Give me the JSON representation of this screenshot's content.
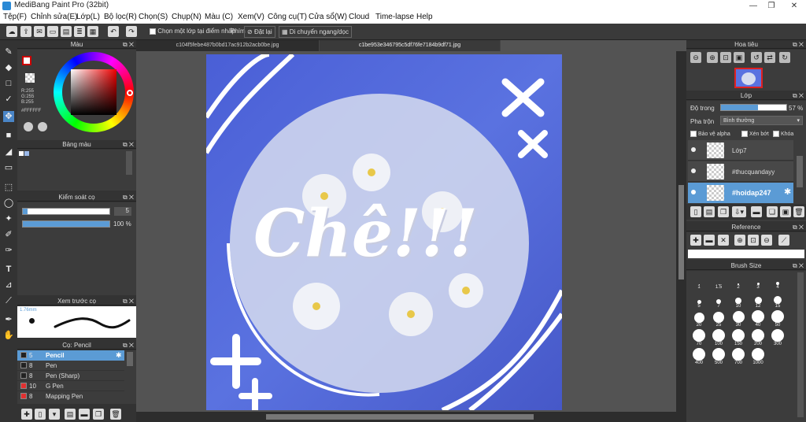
{
  "title": "MediBang Paint Pro (32bit)",
  "menu": [
    "Tệp(F)",
    "Chỉnh sửa(E)",
    "Lớp(L)",
    "Bộ lọc(R)",
    "Chọn(S)",
    "Chụp(N)",
    "Màu (C)",
    "Xem(V)",
    "Công cụ(T)",
    "Cửa sổ(W)",
    "Cloud",
    "Time-lapse",
    "Help"
  ],
  "toolbar": {
    "select_layer_label": "Chọn một lớp tại điểm nhấp",
    "phim_label": "Phím",
    "reset_label": "Đặt lại",
    "move_label": "Di chuyển ngang/dọc"
  },
  "color_panel": {
    "title": "Màu",
    "r": "R:255",
    "g": "G:255",
    "b": "B:255",
    "hex": "#FFFFFF"
  },
  "palette_panel": {
    "title": "Bảng màu"
  },
  "brush_control": {
    "title": "Kiểm soát cọ",
    "size": "5",
    "opacity": "100 %"
  },
  "brush_preview": {
    "title": "Xem trước cọ",
    "size": "1.76mm"
  },
  "brush_list": {
    "title": "Cọ: Pencil",
    "items": [
      {
        "size": "5",
        "name": "Pencil",
        "color": "#222222",
        "selected": true
      },
      {
        "size": "8",
        "name": "Pen",
        "color": "#222222",
        "selected": false
      },
      {
        "size": "8",
        "name": "Pen (Sharp)",
        "color": "#222222",
        "selected": false
      },
      {
        "size": "10",
        "name": "G Pen",
        "color": "#e03030",
        "selected": false
      },
      {
        "size": "8",
        "name": "Mapping Pen",
        "color": "#e03030",
        "selected": false
      }
    ]
  },
  "doc_tabs": [
    "c104f5febe487b0bd17ac912b2acb0be.jpg",
    "c1be953e346795c5df76fe7184b9df71.jpg"
  ],
  "canvas_text": "Chê!!!",
  "navigator": {
    "title": "Hoa tiêu"
  },
  "layer_panel": {
    "title": "Lớp",
    "opacity_label": "Độ trong",
    "opacity_value": "57 %",
    "opacity_fraction": 0.57,
    "blend_label": "Pha trộn",
    "blend_value": "Bình thường",
    "protect_alpha": "Bảo vệ alpha",
    "clipping": "Xén bớt",
    "lock": "Khóa",
    "layers": [
      {
        "name": "Lớp7",
        "selected": false
      },
      {
        "name": "#thucquandayy",
        "selected": false
      },
      {
        "name": "#hoidap247",
        "selected": true
      }
    ]
  },
  "reference": {
    "title": "Reference"
  },
  "brush_size": {
    "title": "Brush Size",
    "sizes": [
      "1",
      "1.5",
      "2",
      "3",
      "4",
      "5",
      "7",
      "10",
      "12",
      "15",
      "20",
      "25",
      "30",
      "40",
      "50",
      "70",
      "100",
      "150",
      "200",
      "300",
      "400",
      "500",
      "700",
      "1000"
    ]
  },
  "colors": {
    "accent": "#5b9bd5",
    "panel": "#3c3c3c",
    "canvas_bg": "#535353"
  }
}
